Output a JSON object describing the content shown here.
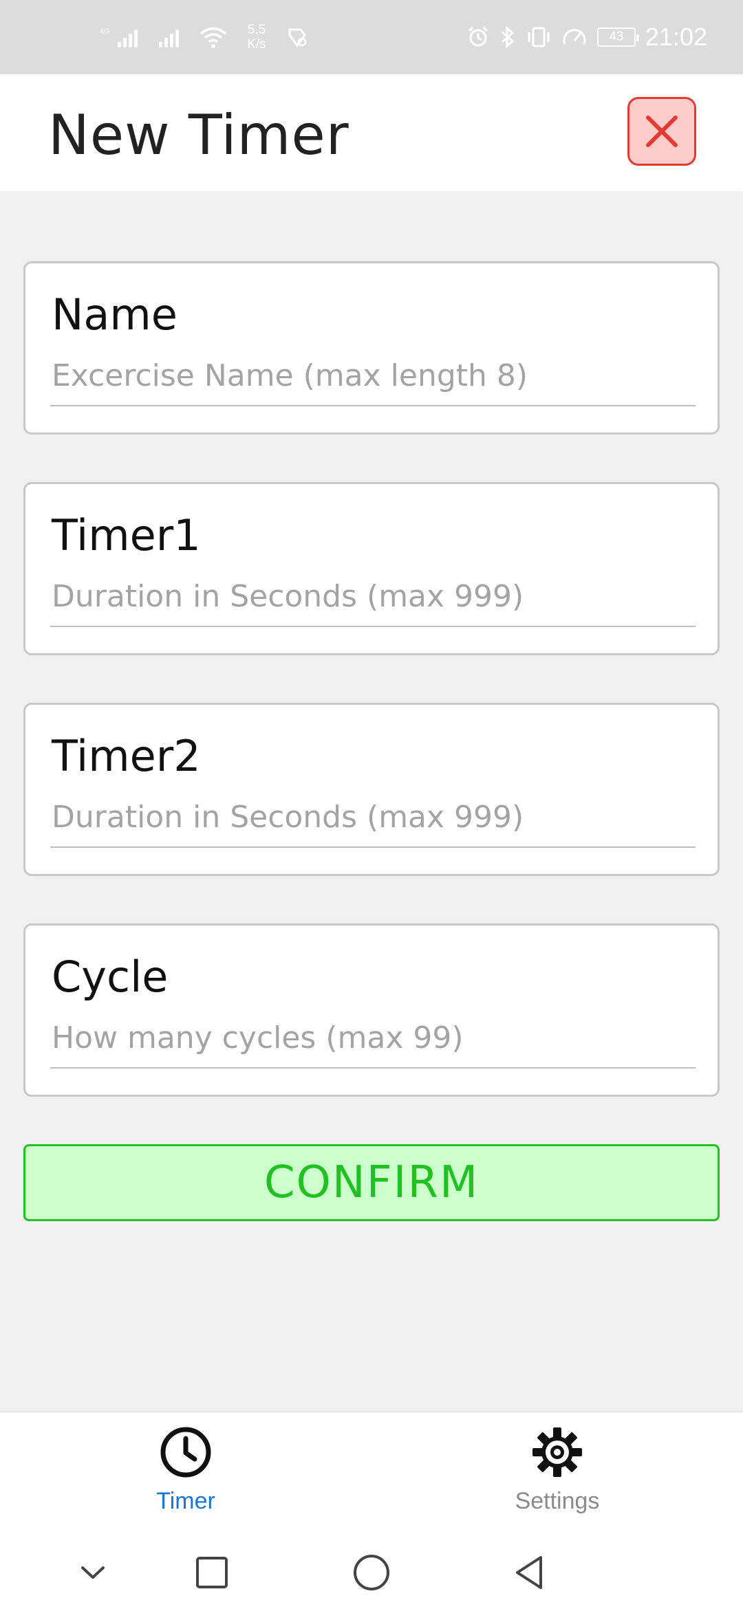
{
  "status_bar": {
    "net_speed_value": "5.5",
    "net_speed_unit": "K/s",
    "battery_level": "43",
    "time": "21:02",
    "icons": [
      "signal-4g-icon",
      "signal-icon",
      "wifi-icon",
      "data-saver-icon",
      "alarm-icon",
      "bluetooth-icon",
      "vibrate-icon",
      "speed-icon",
      "battery-icon"
    ]
  },
  "header": {
    "title": "New Timer",
    "close_icon": "close-icon",
    "accent_color": "#e53935"
  },
  "form": {
    "fields": [
      {
        "label": "Name",
        "placeholder": "Excercise Name (max length 8)",
        "value": ""
      },
      {
        "label": "Timer1",
        "placeholder": "Duration in Seconds (max 999)",
        "value": ""
      },
      {
        "label": "Timer2",
        "placeholder": "Duration in Seconds (max 999)",
        "value": ""
      },
      {
        "label": "Cycle",
        "placeholder": "How many cycles (max 99)",
        "value": ""
      }
    ],
    "confirm_label": "CONFIRM",
    "confirm_color": "#22c022"
  },
  "tabs": [
    {
      "label": "Timer",
      "icon": "clock-icon",
      "active": true
    },
    {
      "label": "Settings",
      "icon": "gear-icon",
      "active": false
    }
  ],
  "active_tab_color": "#1976d2",
  "nav_bar": {
    "icons": [
      "chevron-down-icon",
      "recents-icon",
      "home-icon",
      "back-icon"
    ]
  }
}
